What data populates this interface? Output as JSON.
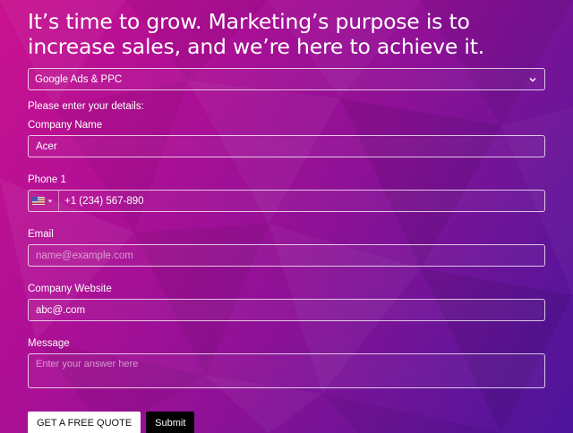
{
  "headline": "It’s time to grow. Marketing’s purpose is to increase sales, and we’re here to achieve it.",
  "service_select": {
    "value": "Google Ads & PPC",
    "icon": "chevron-down-icon"
  },
  "instruction": "Please enter your details:",
  "fields": {
    "company_name": {
      "label": "Company Name",
      "value": "Acer"
    },
    "phone": {
      "label": "Phone 1",
      "value": "+1 (234) 567-890",
      "flag_icon": "us-flag-icon"
    },
    "email": {
      "label": "Email",
      "placeholder": "name@example.com"
    },
    "website": {
      "label": "Company Website",
      "value": "abc@.com"
    },
    "message": {
      "label": "Message",
      "placeholder": "Enter your answer here"
    }
  },
  "buttons": {
    "quote_label": "GET A FREE QUOTE",
    "submit_label": "Submit"
  },
  "colors": {
    "background_start": "#c9128f",
    "background_end": "#4c149a",
    "text": "#ffffff"
  }
}
